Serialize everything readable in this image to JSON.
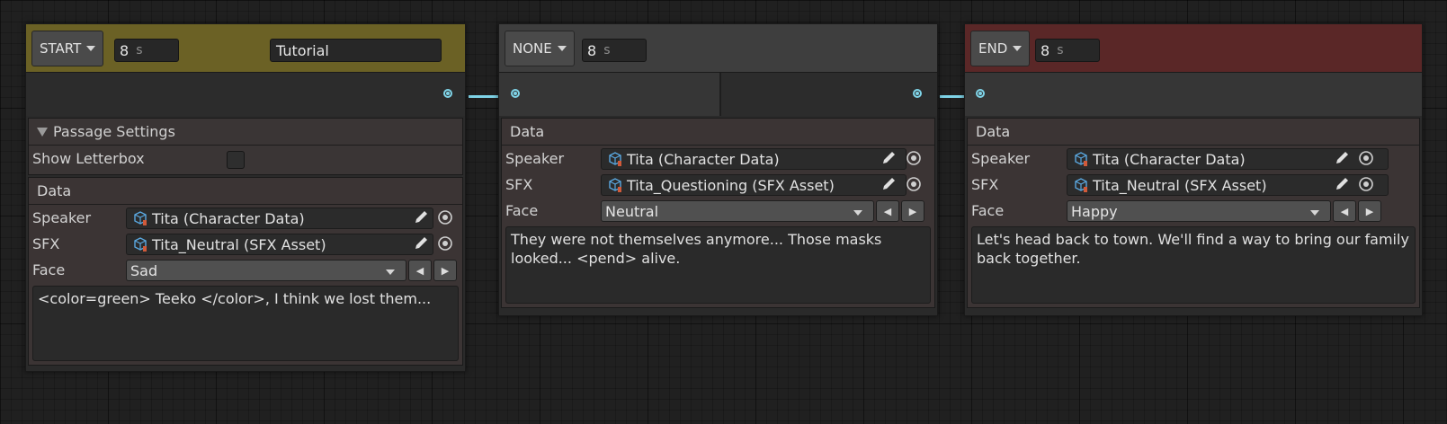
{
  "graph": {
    "nodes": [
      {
        "type": "START",
        "duration": "8",
        "duration_unit": "s",
        "title": "Tutorial",
        "header_color": "#6b6125",
        "passage_settings": {
          "heading": "Passage Settings",
          "letterbox_label": "Show Letterbox",
          "letterbox_checked": false
        },
        "data": {
          "heading": "Data",
          "speaker_label": "Speaker",
          "speaker_value": "Tita (Character Data)",
          "sfx_label": "SFX",
          "sfx_value": "Tita_Neutral (SFX Asset)",
          "face_label": "Face",
          "face_value": "Sad",
          "text": "<color=green> Teeko </color>, I think we lost them..."
        }
      },
      {
        "type": "NONE",
        "duration": "8",
        "duration_unit": "s",
        "header_color": "#3e3e3e",
        "data": {
          "heading": "Data",
          "speaker_label": "Speaker",
          "speaker_value": "Tita (Character Data)",
          "sfx_label": "SFX",
          "sfx_value": "Tita_Questioning (SFX Asset)",
          "face_label": "Face",
          "face_value": "Neutral",
          "text": "They were not themselves anymore... Those masks looked... <pend> alive."
        }
      },
      {
        "type": "END",
        "duration": "8",
        "duration_unit": "s",
        "header_color": "#5a2727",
        "data": {
          "heading": "Data",
          "speaker_label": "Speaker",
          "speaker_value": "Tita (Character Data)",
          "sfx_label": "SFX",
          "sfx_value": "Tita_Neutral (SFX Asset)",
          "face_label": "Face",
          "face_value": "Happy",
          "text": "Let's head back to town. We'll find a way to bring our family back together."
        }
      }
    ],
    "connection_color": "#7fd4e8",
    "icons": [
      "object-field-icon",
      "edit-pencil-icon",
      "object-picker-icon",
      "dropdown-caret-icon",
      "prev-arrow-icon",
      "next-arrow-icon"
    ]
  }
}
